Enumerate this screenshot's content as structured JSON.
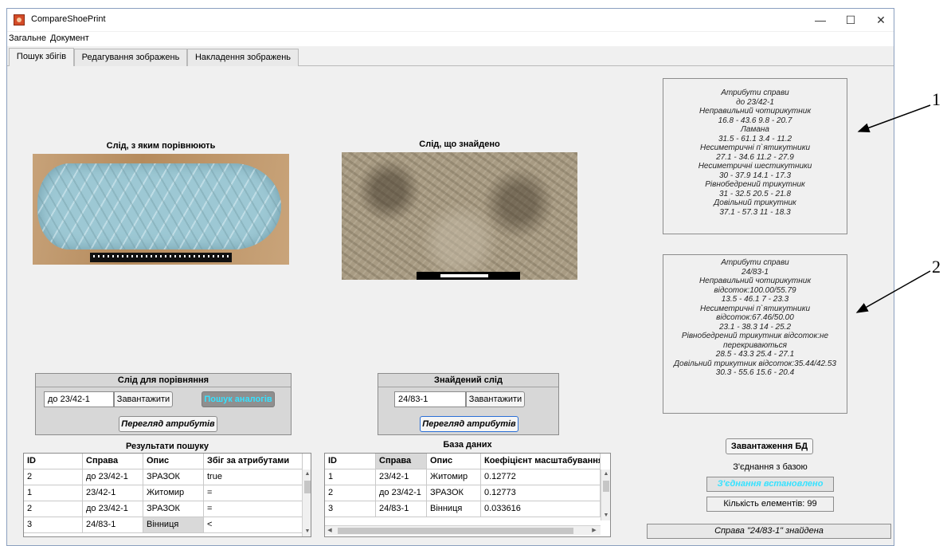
{
  "window": {
    "title": "CompareShoePrint"
  },
  "menu": [
    "Загальне",
    "Документ"
  ],
  "tabs": [
    "Пошук збігів",
    "Редагування зображень",
    "Накладення зображень"
  ],
  "images": {
    "left_caption": "Слід, з яким порівнюють",
    "right_caption": "Слід, що знайдено"
  },
  "attributes_panel_1": {
    "lines": [
      "Атрибути справи",
      "до 23/42-1",
      "Неправильний чотирикутник",
      "16.8 - 43.6   9.8 - 20.7",
      "Ламана",
      "31.5 - 61.1   3.4 - 11.2",
      "Несиметричні п`ятикутники",
      "27.1 - 34.6   11.2 - 27.9",
      "Несиметричні шестикутники",
      "30 - 37.9   14.1 - 17.3",
      "Рівнобедрений трикутник",
      "31 - 32.5   20.5 - 21.8",
      "Довільний трикутник",
      "37.1 - 57.3   11 - 18.3"
    ]
  },
  "attributes_panel_2": {
    "lines": [
      "Атрибути справи",
      "24/83-1",
      "Неправильний чотирикутник",
      "відсоток:100.00/55.79",
      "13.5 - 46.1   7 - 23.3",
      "Несиметричні п`ятикутники відсоток:67.46/50.00",
      "23.1 - 38.3   14 - 25.2",
      "Рівнобедрений трикутник відсоток:не",
      "перекриваються",
      "28.5 - 43.3   25.4 - 27.1",
      "Довільний трикутник відсоток:35.44/42.53",
      "30.3 - 55.6   15.6 - 20.4"
    ]
  },
  "compare_group": {
    "title": "Слід для порівняння",
    "input_value": "до 23/42-1",
    "load_button": "Завантажити",
    "search_button": "Пошук аналогів",
    "view_attributes_button": "Перегляд атрибутів"
  },
  "found_group": {
    "title": "Знайдений слід",
    "input_value": "24/83-1",
    "load_button": "Завантажити",
    "view_attributes_button": "Перегляд атрибутів"
  },
  "results_table": {
    "title": "Результати пошуку",
    "columns": [
      "ID",
      "Справа",
      "Опис",
      "Збіг за атрибутами"
    ],
    "rows": [
      [
        "2",
        "до 23/42-1",
        "ЗРАЗОК",
        "true"
      ],
      [
        "1",
        "23/42-1",
        "Житомир",
        "="
      ],
      [
        "2",
        "до 23/42-1",
        "ЗРАЗОК",
        "="
      ],
      [
        "3",
        "24/83-1",
        "Вінниця",
        "<"
      ]
    ]
  },
  "db_table": {
    "title": "База даних",
    "columns": [
      "ID",
      "Справа",
      "Опис",
      "Коефіцієнт масштабування"
    ],
    "rows": [
      [
        "1",
        "23/42-1",
        "Житомир",
        "0.12772"
      ],
      [
        "2",
        "до 23/42-1",
        "ЗРАЗОК",
        "0.12773"
      ],
      [
        "3",
        "24/83-1",
        "Вінниця",
        "0.033616"
      ]
    ]
  },
  "database_panel": {
    "load_db_button": "Завантаження БД",
    "connection_label": "З'єднання з базою",
    "connection_status": "З'єднання встановлено",
    "element_count": "Кількість елементів: 99"
  },
  "status_bar": {
    "text": "Справа \"24/83-1\" знайдена"
  },
  "external_labels": [
    "1",
    "2"
  ],
  "colors": {
    "highlight_text": "#36e2ff",
    "focus_border": "#2a6fd6",
    "panel_background": "#f0f0f0"
  }
}
